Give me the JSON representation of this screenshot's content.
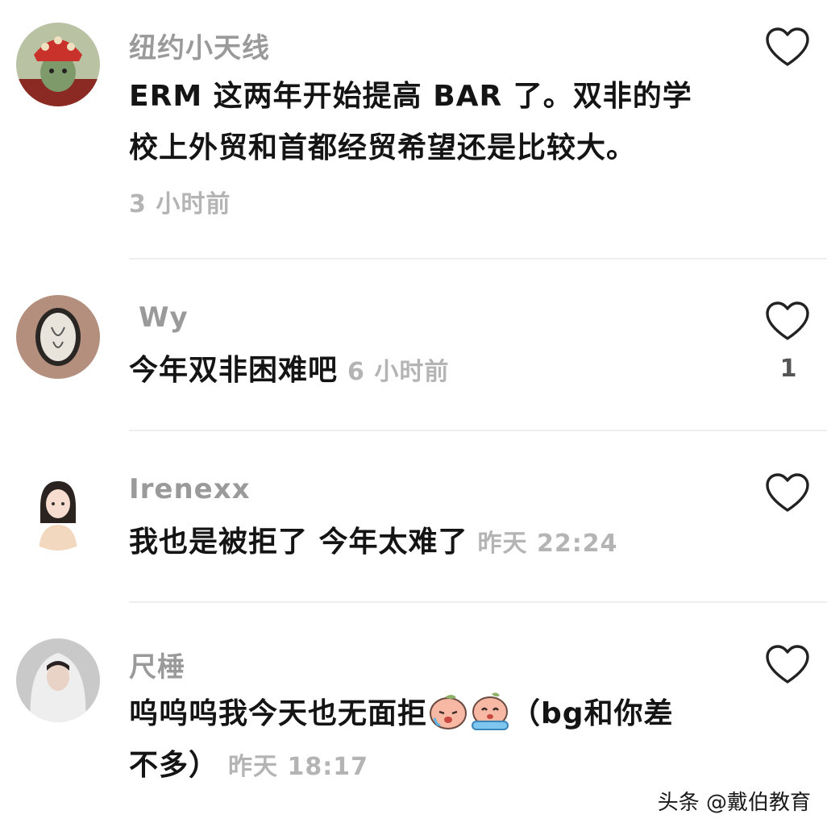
{
  "comments": [
    {
      "username": "纽约小天线",
      "text_line1": "ERM 这两年开始提高 BAR 了。双非的学",
      "text_line2": "校上外贸和首都经贸希望还是比较大。",
      "time": "3 小时前",
      "avatar_icon": "avatar-red-headdress"
    },
    {
      "username": "Wy",
      "text": "今年双非困难吧",
      "time": "6 小时前",
      "likes": "1",
      "avatar_icon": "avatar-candle-label"
    },
    {
      "username": "Irenexx",
      "text": "我也是被拒了 今年太难了",
      "time": "昨天 22:24",
      "avatar_icon": "avatar-illustrated-girl"
    },
    {
      "username": "尺棰",
      "text_line1": "呜呜呜我今天也无面拒",
      "text_line1_after": "（bg和你差",
      "text_line2": "不多）",
      "time": "昨天 18:17",
      "avatar_icon": "avatar-bride-veil"
    }
  ],
  "watermark": "头条 @戴伯教育",
  "colors": {
    "username": "#9a9a9a",
    "timestamp": "#b4b4b4",
    "body_text": "#141414",
    "divider": "#eeeeee"
  }
}
